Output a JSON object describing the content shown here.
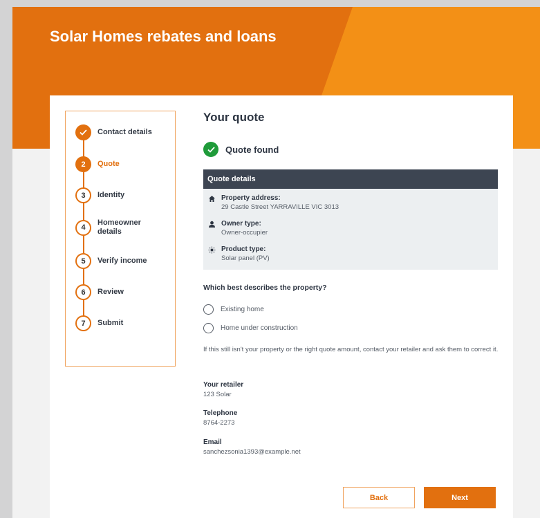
{
  "hero": {
    "title": "Solar Homes rebates and loans"
  },
  "colors": {
    "primary": "#e2700f",
    "accent": "#f39016",
    "success": "#1f9b3a",
    "header_dark": "#3d4552"
  },
  "steps": [
    {
      "label": "Contact details",
      "state": "done",
      "icon": "check-icon"
    },
    {
      "number": "2",
      "label": "Quote",
      "state": "active"
    },
    {
      "number": "3",
      "label": "Identity",
      "state": "pending"
    },
    {
      "number": "4",
      "label": "Homeowner details",
      "state": "pending"
    },
    {
      "number": "5",
      "label": "Verify income",
      "state": "pending"
    },
    {
      "number": "6",
      "label": "Review",
      "state": "pending"
    },
    {
      "number": "7",
      "label": "Submit",
      "state": "pending"
    }
  ],
  "main": {
    "title": "Your quote",
    "status": "Quote found",
    "quote_details": {
      "heading": "Quote details",
      "items": [
        {
          "icon": "home-icon",
          "label": "Property address:",
          "value": "29 Castle Street YARRAVILLE VIC 3013"
        },
        {
          "icon": "person-icon",
          "label": "Owner type:",
          "value": "Owner-occupier"
        },
        {
          "icon": "sun-icon",
          "label": "Product type:",
          "value": "Solar panel (PV)"
        }
      ]
    },
    "question": "Which best describes the property?",
    "options": [
      "Existing home",
      "Home under construction"
    ],
    "note": "If this still isn't your property or the right quote amount, contact your retailer and ask them to correct it.",
    "retailer": {
      "retailer_label": "Your retailer",
      "retailer_value": "123 Solar",
      "phone_label": "Telephone",
      "phone_value": "8764-2273",
      "email_label": "Email",
      "email_value": "sanchezsonia1393@example.net"
    },
    "buttons": {
      "back": "Back",
      "next": "Next"
    }
  }
}
